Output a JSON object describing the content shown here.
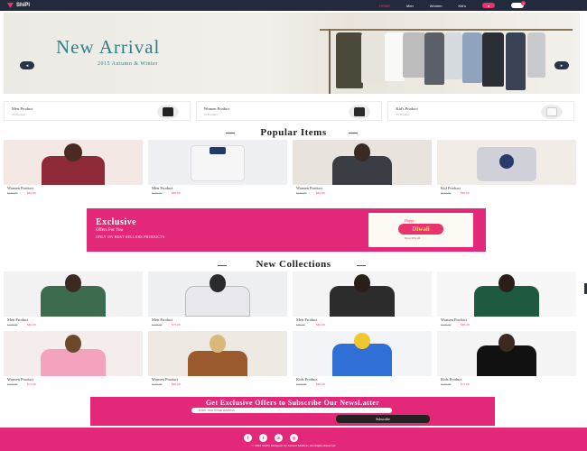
{
  "nav": {
    "logo_text": "ShiPi",
    "links": [
      {
        "label": "HOME",
        "active": true
      },
      {
        "label": "Men",
        "active": false
      },
      {
        "label": "Women",
        "active": false
      },
      {
        "label": "Kid's",
        "active": false
      }
    ],
    "user_icon": "user-icon",
    "cart_icon": "cart-icon",
    "cart_count": "0"
  },
  "hero": {
    "title": "New Arrival",
    "subtitle": "2015 Autumn & Winter",
    "prev": "◂",
    "next": "▸"
  },
  "categories": [
    {
      "name": "Men Product",
      "count": "25 Product",
      "color": "#222"
    },
    {
      "name": "Women Product",
      "count": "25 Product",
      "color": "#2b2b2b"
    },
    {
      "name": "Kid's Product",
      "count": "25 Product",
      "color": "#f0f0f0"
    }
  ],
  "popular": {
    "title": "Popular Items",
    "items": [
      {
        "name": "Women Product",
        "old_price": "$120.00",
        "price": "$65.00",
        "bg": "#f3e8e4",
        "body": "#8e2a3a",
        "head": "#4a2a22"
      },
      {
        "name": "Men Product",
        "old_price": "$120.00",
        "price": "$65.00",
        "bg": "#eef0f3",
        "body": "#f6f6f6",
        "head": "#1f3a6b"
      },
      {
        "name": "Women Product",
        "old_price": "$120.00",
        "price": "$65.00",
        "bg": "#e9e3dd",
        "body": "#3b3d44",
        "head": "#3a2a24"
      },
      {
        "name": "Kid Product",
        "old_price": "$120.00",
        "price": "$65.00",
        "bg": "#f1ece6",
        "body": "#cfd0d8",
        "head": "#2a3b6b"
      }
    ]
  },
  "promo": {
    "title": "Exclusive",
    "subtitle": "Offers For You",
    "caption": "ONLY ON BEST SELLERS PRODUCTS",
    "art_top": "Happy",
    "art_main": "Diwali",
    "art_sub": "Up to 50% off"
  },
  "collections": {
    "title": "New Collections",
    "items": [
      {
        "name": "Men Product",
        "old_price": "$120.00",
        "price": "$65.00",
        "bg": "#f2f2f2",
        "body": "#3d6b4e",
        "head": "#3b2a20"
      },
      {
        "name": "Men Product",
        "old_price": "$120.00",
        "price": "$75.00",
        "bg": "#eef0f2",
        "body": "#e8e8ee",
        "head": "#2a2a2a"
      },
      {
        "name": "Men Product",
        "old_price": "$90.00",
        "price": "$65.00",
        "bg": "#f4f4f4",
        "body": "#2c2c2c",
        "head": "#2a1e18"
      },
      {
        "name": "Women Product",
        "old_price": "$120.00",
        "price": "$65.00",
        "bg": "#f7f7f7",
        "body": "#1e5a40",
        "head": "#2a1e18"
      },
      {
        "name": "Women Product",
        "old_price": "$100.00",
        "price": "$75.00",
        "bg": "#f5ecec",
        "body": "#f3a3bd",
        "head": "#6b4a2a"
      },
      {
        "name": "Women Product",
        "old_price": "$120.00",
        "price": "$65.00",
        "bg": "#efe9e3",
        "body": "#9a5a2e",
        "head": "#d9b97b"
      },
      {
        "name": "Kids Product",
        "old_price": "$100.00",
        "price": "$65.00",
        "bg": "#f2f4f7",
        "body": "#2f6fd6",
        "head": "#f0c72e"
      },
      {
        "name": "Kids Product",
        "old_price": "$120.00",
        "price": "$75.00",
        "bg": "#f4f4f4",
        "body": "#111",
        "head": "#3a2a20"
      }
    ]
  },
  "newsletter": {
    "title": "Get Exclusive Offers to Subscribe Our NewsLatter",
    "placeholder": "Enter Your Email Address",
    "button": "Subscribe"
  },
  "footer": {
    "socials": [
      {
        "icon": "facebook-icon",
        "glyph": "f"
      },
      {
        "icon": "twitter-icon",
        "glyph": "t"
      },
      {
        "icon": "linkedin-icon",
        "glyph": "in"
      },
      {
        "icon": "instagram-icon",
        "glyph": "◎"
      }
    ],
    "copyright": "© 2024 ShiPi | Designed by Sanwar Mallick | All Rights Reserved"
  },
  "colors": {
    "accent": "#e32879",
    "nav": "#232a3b",
    "teal": "#2f7f86"
  }
}
